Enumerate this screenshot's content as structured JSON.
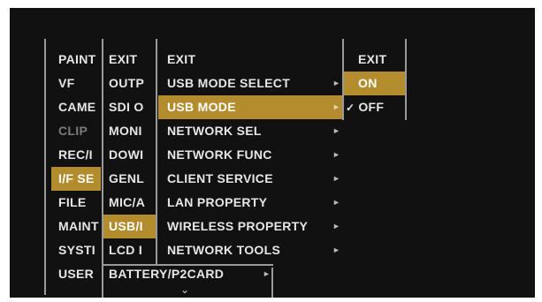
{
  "col1": [
    {
      "label": "PAINT",
      "state": "normal"
    },
    {
      "label": "VF",
      "state": "normal"
    },
    {
      "label": "CAME",
      "state": "normal"
    },
    {
      "label": "CLIP",
      "state": "dim"
    },
    {
      "label": "REC/I",
      "state": "normal"
    },
    {
      "label": "I/F SE",
      "state": "selected"
    },
    {
      "label": "FILE",
      "state": "normal"
    },
    {
      "label": "MAINT",
      "state": "normal"
    },
    {
      "label": "SYSTI",
      "state": "normal"
    },
    {
      "label": "USER",
      "state": "normal"
    }
  ],
  "col2": [
    {
      "label": "EXIT",
      "state": "normal"
    },
    {
      "label": "OUTP",
      "state": "normal"
    },
    {
      "label": "SDI O",
      "state": "normal"
    },
    {
      "label": "MONI",
      "state": "normal"
    },
    {
      "label": "DOWI",
      "state": "normal"
    },
    {
      "label": "GENL",
      "state": "normal"
    },
    {
      "label": "MIC/A",
      "state": "normal"
    },
    {
      "label": "USB/I",
      "state": "selected"
    },
    {
      "label": "LCD I",
      "state": "normal"
    },
    {
      "label": "BATTERY/P2CARD",
      "state": "normal",
      "arrow": "►"
    }
  ],
  "col3": [
    {
      "label": "EXIT",
      "arrow": ""
    },
    {
      "label": "USB MODE SELECT",
      "arrow": "►"
    },
    {
      "label": "USB MODE",
      "arrow": "►",
      "state": "selected"
    },
    {
      "label": "NETWORK SEL",
      "arrow": "►"
    },
    {
      "label": "NETWORK FUNC",
      "arrow": "►"
    },
    {
      "label": "CLIENT SERVICE",
      "arrow": "►"
    },
    {
      "label": "LAN PROPERTY",
      "arrow": "►"
    },
    {
      "label": "WIRELESS PROPERTY",
      "arrow": "►"
    },
    {
      "label": "NETWORK TOOLS",
      "arrow": "►"
    }
  ],
  "col4": [
    {
      "label": "EXIT",
      "check": ""
    },
    {
      "label": "ON",
      "check": "",
      "state": "selected"
    },
    {
      "label": "OFF",
      "check": "✓"
    }
  ],
  "more_indicator": "⌄",
  "colors": {
    "background": "#111111",
    "highlight": "#b38c2e",
    "text": "#e6e6e6",
    "dim": "#7a7a7a"
  }
}
